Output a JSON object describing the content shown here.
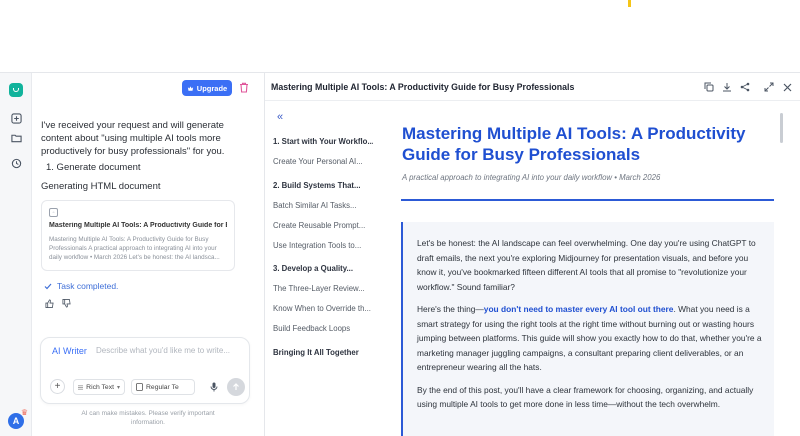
{
  "colors": {
    "accent": "#3b6ff5",
    "heading_blue": "#1f4fd1",
    "brand_green": "#11b39c",
    "trash_pink": "#e0559a"
  },
  "rail": {
    "avatar_letter": "A"
  },
  "chat": {
    "upgrade_label": "Upgrade",
    "message": "I've received your request and will generate content about \"using multiple AI tools more productively for busy professionals\" for you.",
    "step": "1. Generate document",
    "generating": "Generating HTML document",
    "card": {
      "title": "Mastering Multiple AI Tools: A Productivity Guide for Busy Professionals",
      "excerpt": "Mastering Multiple AI Tools: A Productivity Guide for Busy Professionals A practical approach to integrating AI into your daily workflow • March 2026 Let's be honest: the AI landsca..."
    },
    "task_status": "Task completed.",
    "composer": {
      "mode_label": "AI Writer",
      "placeholder": "Describe what you'd like me to write...",
      "format_select": "Rich Text",
      "style_select": "Regular Te"
    },
    "disclaimer": "AI can make mistakes. Please verify important information."
  },
  "doc": {
    "header_title": "Mastering Multiple AI Tools: A Productivity Guide for Busy Professionals",
    "toc": [
      {
        "label": "1. Start with Your Workflo...",
        "section": true
      },
      {
        "label": "Create Your Personal AI...",
        "section": false
      },
      {
        "label": "2. Build Systems That...",
        "section": true
      },
      {
        "label": "Batch Similar AI Tasks...",
        "section": false
      },
      {
        "label": "Create Reusable Prompt...",
        "section": false
      },
      {
        "label": "Use Integration Tools to...",
        "section": false
      },
      {
        "label": "3. Develop a Quality...",
        "section": true
      },
      {
        "label": "The Three-Layer Review...",
        "section": false
      },
      {
        "label": "Know When to Override th...",
        "section": false
      },
      {
        "label": "Build Feedback Loops",
        "section": false
      },
      {
        "label": "Bringing It All Together",
        "section": true
      }
    ],
    "article": {
      "title": "Mastering Multiple AI Tools: A Productivity Guide for Busy Professionals",
      "subtitle": "A practical approach to integrating AI into your daily workflow • March 2026",
      "p1": "Let's be honest: the AI landscape can feel overwhelming. One day you're using ChatGPT to draft emails, the next you're exploring Midjourney for presentation visuals, and before you know it, you've bookmarked fifteen different AI tools that all promise to \"revolutionize your workflow.\" Sound familiar?",
      "p2_before": "Here's the thing—",
      "p2_highlight": "you don't need to master every AI tool out there",
      "p2_after": ". What you need is a smart strategy for using the right tools at the right time without burning out or wasting hours jumping between platforms. This guide will show you exactly how to do that, whether you're a marketing manager juggling campaigns, a consultant preparing client deliverables, or an entrepreneur wearing all the hats.",
      "p3": "By the end of this post, you'll have a clear framework for choosing, organizing, and actually using multiple AI tools to get more done in less time—without the tech overwhelm."
    }
  }
}
